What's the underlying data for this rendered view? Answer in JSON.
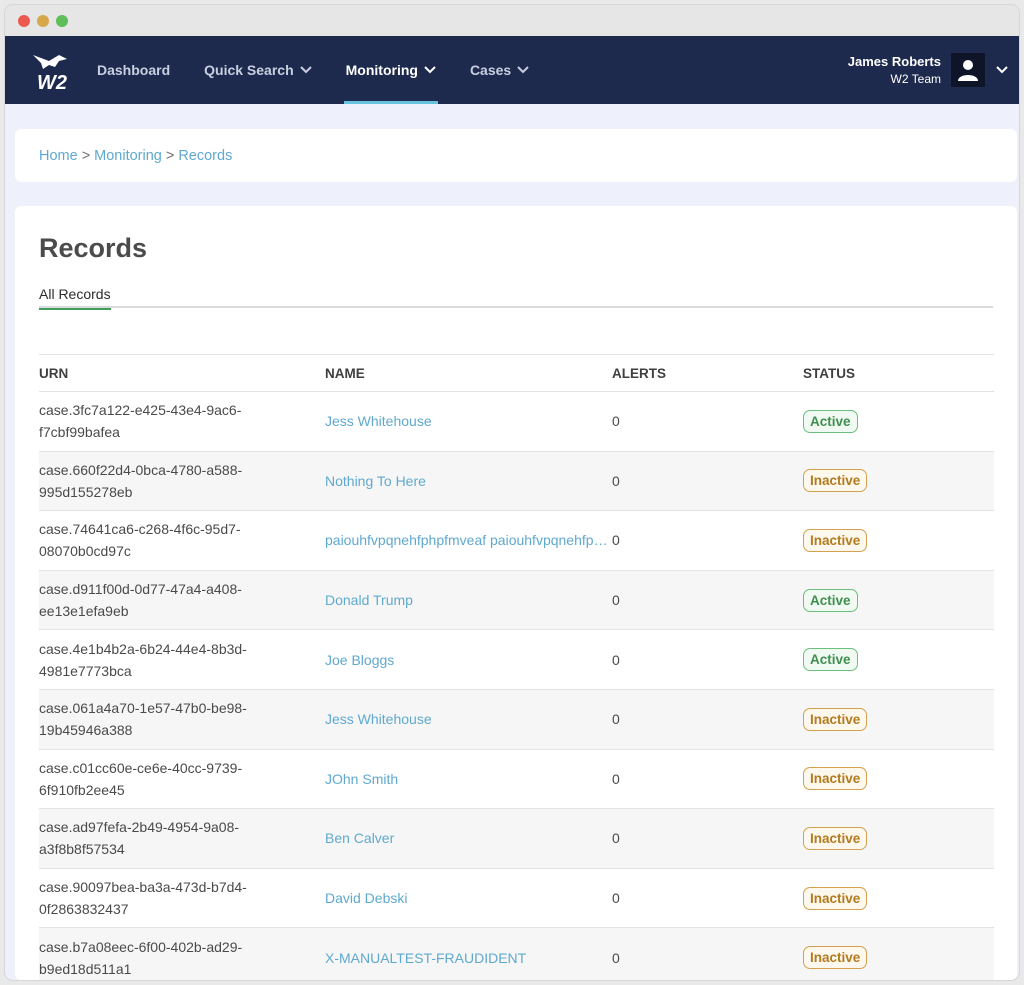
{
  "window": {
    "dots": [
      "#ec5a4f",
      "#d6a84a",
      "#5fbd5a"
    ]
  },
  "navbar": {
    "logo_text": "W2",
    "items": [
      {
        "label": "Dashboard",
        "has_dropdown": false,
        "active": false
      },
      {
        "label": "Quick Search",
        "has_dropdown": true,
        "active": false
      },
      {
        "label": "Monitoring",
        "has_dropdown": true,
        "active": true
      },
      {
        "label": "Cases",
        "has_dropdown": true,
        "active": false
      }
    ],
    "user": {
      "name": "James Roberts",
      "team": "W2 Team",
      "icon": "user-icon"
    }
  },
  "breadcrumb": {
    "items": [
      "Home",
      "Monitoring",
      "Records"
    ],
    "separator": ">"
  },
  "main": {
    "title": "Records",
    "tabs": [
      {
        "label": "All Records",
        "active": true
      }
    ],
    "table": {
      "headers": [
        "URN",
        "NAME",
        "ALERTS",
        "STATUS"
      ],
      "rows": [
        {
          "urn": "case.3fc7a122-e425-43e4-9ac6-f7cbf99bafea",
          "name": "Jess Whitehouse",
          "alerts": "0",
          "status": "Active"
        },
        {
          "urn": "case.660f22d4-0bca-4780-a588-995d155278eb",
          "name": "Nothing To Here",
          "alerts": "0",
          "status": "Inactive"
        },
        {
          "urn": "case.74641ca6-c268-4f6c-95d7-08070b0cd97c",
          "name": "paiouhfvpqnehfphpfmveaf paiouhfvpqnehfphpfmveaf",
          "alerts": "0",
          "status": "Inactive"
        },
        {
          "urn": "case.d911f00d-0d77-47a4-a408-ee13e1efa9eb",
          "name": "Donald Trump",
          "alerts": "0",
          "status": "Active"
        },
        {
          "urn": "case.4e1b4b2a-6b24-44e4-8b3d-4981e7773bca",
          "name": "Joe Bloggs",
          "alerts": "0",
          "status": "Active"
        },
        {
          "urn": "case.061a4a70-1e57-47b0-be98-19b45946a388",
          "name": "Jess Whitehouse",
          "alerts": "0",
          "status": "Inactive"
        },
        {
          "urn": "case.c01cc60e-ce6e-40cc-9739-6f910fb2ee45",
          "name": "JOhn Smith",
          "alerts": "0",
          "status": "Inactive"
        },
        {
          "urn": "case.ad97fefa-2b49-4954-9a08-a3f8b8f57534",
          "name": "Ben Calver",
          "alerts": "0",
          "status": "Inactive"
        },
        {
          "urn": "case.90097bea-ba3a-473d-b7d4-0f2863832437",
          "name": "David Debski",
          "alerts": "0",
          "status": "Inactive"
        },
        {
          "urn": "case.b7a08eec-6f00-402b-ad29-b9ed18d511a1",
          "name": "X-MANUALTEST-FRAUDIDENT",
          "alerts": "0",
          "status": "Inactive"
        }
      ]
    }
  },
  "colors": {
    "navbar": "#1d2a4d",
    "link": "#5fa9cf",
    "active_badge": "#3f8f4e",
    "inactive_badge": "#b37a1e",
    "nav_underline": "#67c2dd"
  }
}
